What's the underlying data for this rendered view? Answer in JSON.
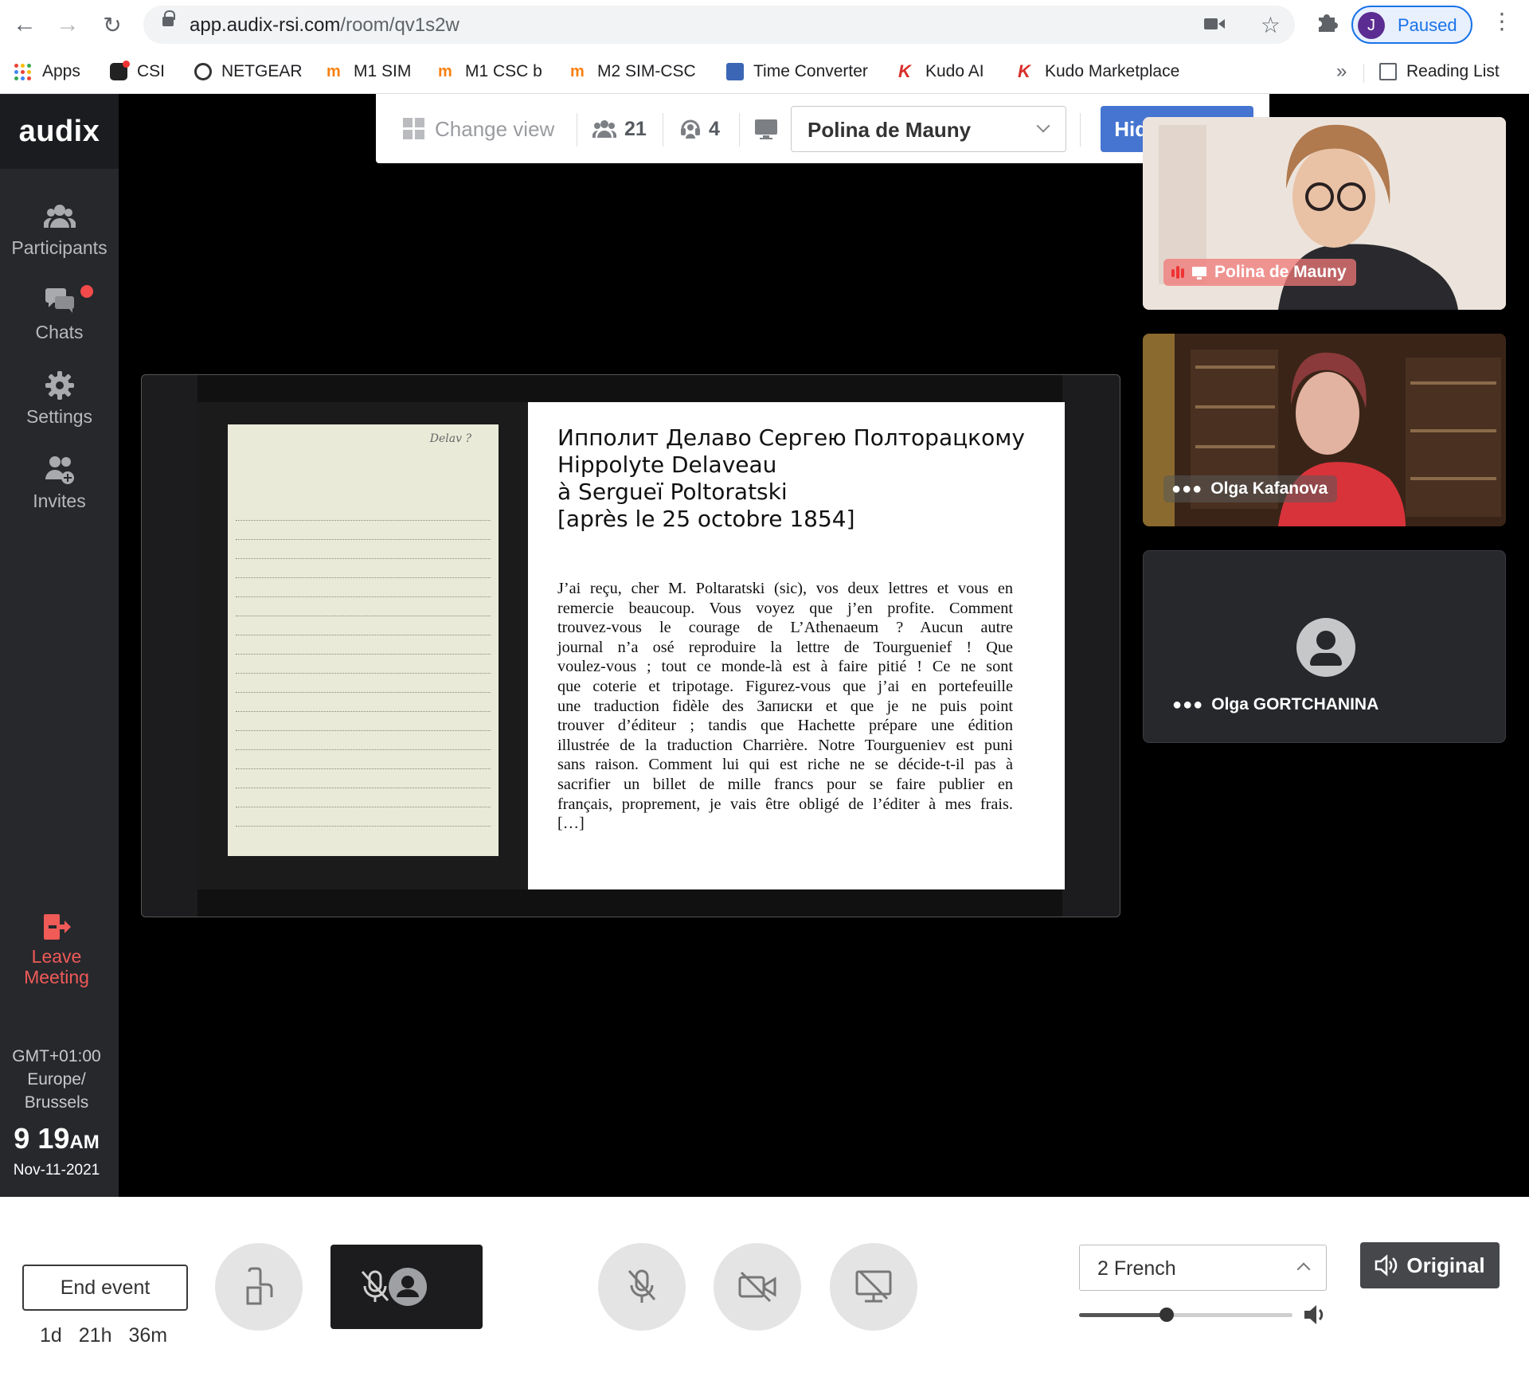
{
  "browser": {
    "url_host": "app.audix-rsi.com",
    "url_path": "/room/qv1s2w",
    "profile_initial": "J",
    "profile_status": "Paused",
    "bookmarks": [
      {
        "label": "Apps",
        "icon": "apps-grid-icon"
      },
      {
        "label": "CSI",
        "icon": "csi-icon"
      },
      {
        "label": "NETGEAR",
        "icon": "netgear-icon"
      },
      {
        "label": "M1 SIM",
        "icon": "moodle-icon"
      },
      {
        "label": "M1 CSC b",
        "icon": "moodle-icon"
      },
      {
        "label": "M2 SIM-CSC",
        "icon": "moodle-icon"
      },
      {
        "label": "Time Converter",
        "icon": "time-converter-icon"
      },
      {
        "label": "Kudo AI",
        "icon": "kudo-icon"
      },
      {
        "label": "Kudo Marketplace",
        "icon": "kudo-icon"
      }
    ],
    "more_label": "»",
    "reading_list": "Reading List"
  },
  "app": {
    "logo": "audix",
    "sidebar": {
      "items": [
        {
          "label": "Participants",
          "icon": "participants-icon"
        },
        {
          "label": "Chats",
          "icon": "chats-icon",
          "unread": true
        },
        {
          "label": "Settings",
          "icon": "gear-icon"
        },
        {
          "label": "Invites",
          "icon": "invite-user-icon"
        }
      ],
      "leave_line1": "Leave",
      "leave_line2": "Meeting",
      "tz_line1": "GMT+01:00",
      "tz_line2": "Europe/",
      "tz_line3": "Brussels",
      "time": "9 19",
      "ampm": "AM",
      "date": "Nov-11-2021"
    },
    "toolbar": {
      "change_view": "Change view",
      "participant_count": "21",
      "interpreter_count": "4",
      "speaker_selected": "Polina de Mauny",
      "hide_sharing": "Hide sharing"
    },
    "slide": {
      "page_mark": "Delav ?",
      "title_lines": [
        "Ипполит Делаво Сергею Полторацкому",
        "Hippolyte Delaveau",
        "à Sergueï Poltoratski",
        "[après le 25 octobre 1854]"
      ],
      "body_lines": [
        "J’ai reçu, cher M. Poltaratski (sic), vos deux lettres et vous en",
        "remercie beaucoup. Vous voyez que j’en profite. Comment",
        "trouvez-vous le courage de L’Athenaeum ? Aucun autre",
        "journal n’a osé reproduire la lettre de Tourguenief ! Que",
        "voulez-vous ; tout ce monde-là est à faire pitié ! Ce ne sont",
        "que coterie et tripotage. Figurez-vous que j’ai en portefeuille",
        "une traduction fidèle des Записки et que je ne puis point",
        "trouver d’éditeur ; tandis que Hachette prépare une édition",
        "illustrée de la traduction Charrière. Notre Tourgueniev est puni",
        "sans raison. Comment lui qui est riche ne se décide-t-il pas à",
        "sacrifier un billet de mille francs pour se faire publier en",
        "français, proprement, je vais être obligé de l’éditer à mes frais.",
        "[…]"
      ]
    },
    "participants": [
      {
        "name": "Polina de Mauny",
        "speaking": true,
        "video": true
      },
      {
        "name": "Olga Kafanova",
        "speaking": false,
        "video": true
      },
      {
        "name": "Olga GORTCHANINA",
        "speaking": false,
        "video": false
      }
    ]
  },
  "bottom_bar": {
    "end_event": "End event",
    "timer_days": "1d",
    "timer_hours": "21h",
    "timer_minutes": "36m",
    "language_selected": "2 French",
    "volume_level": 0.41,
    "original_label": "Original"
  },
  "colors": {
    "accent_blue": "#4675d1",
    "leave_red": "#f05a57",
    "sidebar_bg": "#26282c",
    "notification_dot": "#f44a4a"
  }
}
